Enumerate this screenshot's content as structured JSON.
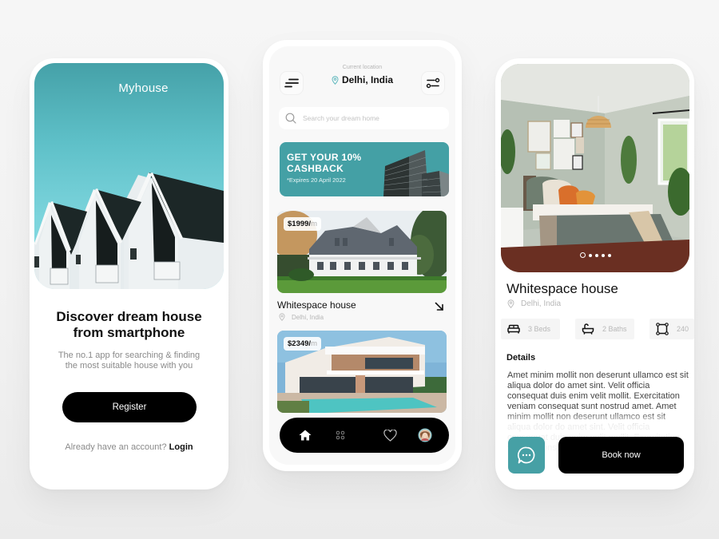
{
  "colors": {
    "accent": "#44a0a5",
    "dark": "#000000",
    "muted_text": "#8a8a8a"
  },
  "onboarding": {
    "brand": "Myhouse",
    "title_line1": "Discover dream house",
    "title_line2": "from smartphone",
    "subtitle_line1": "The no.1 app for searching & finding",
    "subtitle_line2": "the most suitable house with you",
    "register_label": "Register",
    "login_prompt": "Already have an account?",
    "login_label": "Login"
  },
  "home": {
    "location_label": "Current location",
    "location_value": "Delhi, India",
    "menu_icon": "menu-icon",
    "filter_icon": "filter-icon",
    "search": {
      "placeholder": "Search your dream home",
      "value": ""
    },
    "promo": {
      "title_line1": "GET YOUR 10%",
      "title_line2": "CASHBACK",
      "expiry": "*Expires 20 April 2022"
    },
    "listings": [
      {
        "price": "$1999/",
        "price_unit": "m",
        "name": "Whitespace house",
        "location": "Delhi, India"
      },
      {
        "price": "$2349/",
        "price_unit": "m"
      }
    ],
    "tabbar": [
      {
        "name": "home",
        "icon": "home-icon",
        "active": true
      },
      {
        "name": "categories",
        "icon": "grid-icon",
        "active": false
      },
      {
        "name": "favorites",
        "icon": "heart-icon",
        "active": false
      },
      {
        "name": "profile",
        "icon": "avatar",
        "active": false
      }
    ]
  },
  "detail": {
    "carousel": {
      "total": 5,
      "active_index": 0
    },
    "title": "Whitespace house",
    "location": "Delhi, India",
    "features": [
      {
        "icon": "bed-icon",
        "label": "3 Beds"
      },
      {
        "icon": "bath-icon",
        "label": "2 Baths"
      },
      {
        "icon": "area-icon",
        "label": "240"
      }
    ],
    "details_heading": "Details",
    "details_text": "Amet minim mollit non deserunt ullamco est sit aliqua dolor do amet sint. Velit officia consequat duis enim velit mollit. Exercitation veniam consequat sunt nostrud amet. Amet minim mollit non deserunt ullamco est sit aliqua dolor do amet sint. Velit officia consequat duis enim velit mollit. Exercitation veniam consequat sunt",
    "book_label": "Book now",
    "chat_icon": "chat-icon"
  }
}
